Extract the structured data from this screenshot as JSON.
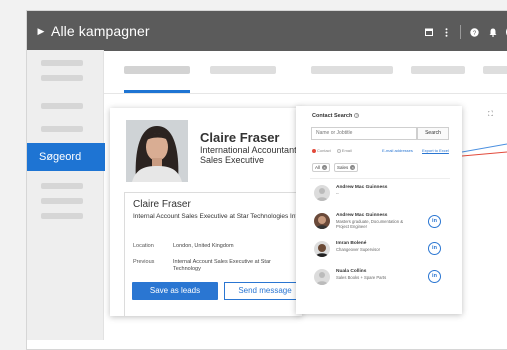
{
  "app": {
    "title": "Alle kampagner"
  },
  "sidebar": {
    "active_label": "Søgeord"
  },
  "profile": {
    "name": "Claire Fraser",
    "title_line1": "International Accountant",
    "title_line2": "Sales Executive",
    "detail_name": "Claire Fraser",
    "detail_desc": "Internal Account Sales Executive at Star Technologies Internet",
    "location_label": "Location",
    "location_value": "London, United Kingdom",
    "previous_label": "Previous",
    "previous_value": "Internal Account Sales Executive at Star Technology",
    "save_label": "Save as leads",
    "message_label": "Send message"
  },
  "contact_search": {
    "title": "Contact Search",
    "placeholder": "Name or Jobtitle",
    "search_label": "Search",
    "radio_contact": "Contact",
    "radio_email": "Email",
    "email_link": "E-mail addresses",
    "export_link": "Export to Excel",
    "chips": [
      "All",
      "Sales"
    ],
    "people": [
      {
        "name": "Andrew Mac Guinness",
        "desc": "--",
        "linkedin": false
      },
      {
        "name": "Andrew Mac Guinness",
        "desc": "Masters graduate, Documentation & Project Engineer",
        "linkedin": true
      },
      {
        "name": "Imran Bolené",
        "desc": "Changeover Supervisor",
        "linkedin": true
      },
      {
        "name": "Nuala Collins",
        "desc": "Sales Books + Spare Parts",
        "linkedin": true
      }
    ]
  },
  "colors": {
    "accent": "#1e74d3",
    "topbar": "#5b5b5b",
    "radio_on": "#e24a3b"
  },
  "icons": {
    "linkedin": "in"
  }
}
